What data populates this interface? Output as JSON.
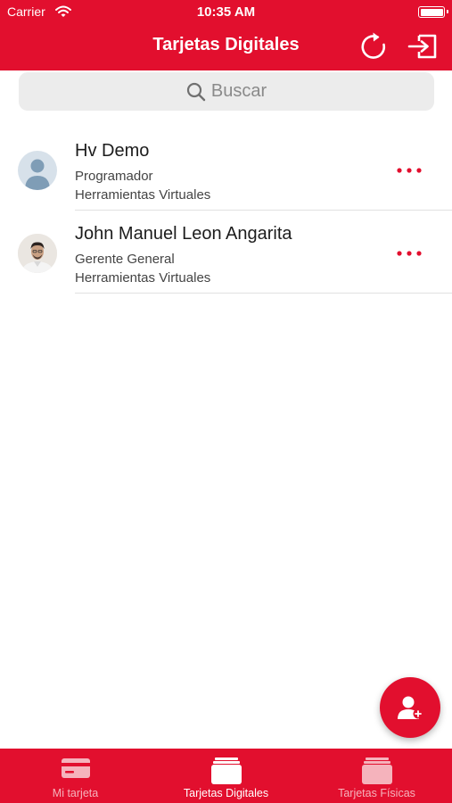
{
  "status_bar": {
    "carrier": "Carrier",
    "time": "10:35 AM"
  },
  "header": {
    "title": "Tarjetas Digitales",
    "refresh_icon": "refresh-icon",
    "logout_icon": "logout-icon"
  },
  "search": {
    "placeholder": "Buscar"
  },
  "contacts": [
    {
      "name": "Hv Demo",
      "role": "Programador",
      "company": "Herramientas Virtuales",
      "avatar": "generic-avatar-icon"
    },
    {
      "name": "John Manuel Leon Angarita",
      "role": "Gerente General",
      "company": "Herramientas Virtuales",
      "avatar": "photo-avatar"
    }
  ],
  "fab": {
    "icon": "add-contact-icon"
  },
  "tabs": [
    {
      "label": "Mi tarjeta",
      "icon": "card-icon",
      "active": false
    },
    {
      "label": "Tarjetas Digitales",
      "icon": "card-stack-icon",
      "active": true
    },
    {
      "label": "Tarjetas Físicas",
      "icon": "card-stack-icon",
      "active": false
    }
  ],
  "colors": {
    "brand_red": "#e20f2e",
    "tab_inactive": "#f5b3bc",
    "search_bg": "#ececec"
  }
}
